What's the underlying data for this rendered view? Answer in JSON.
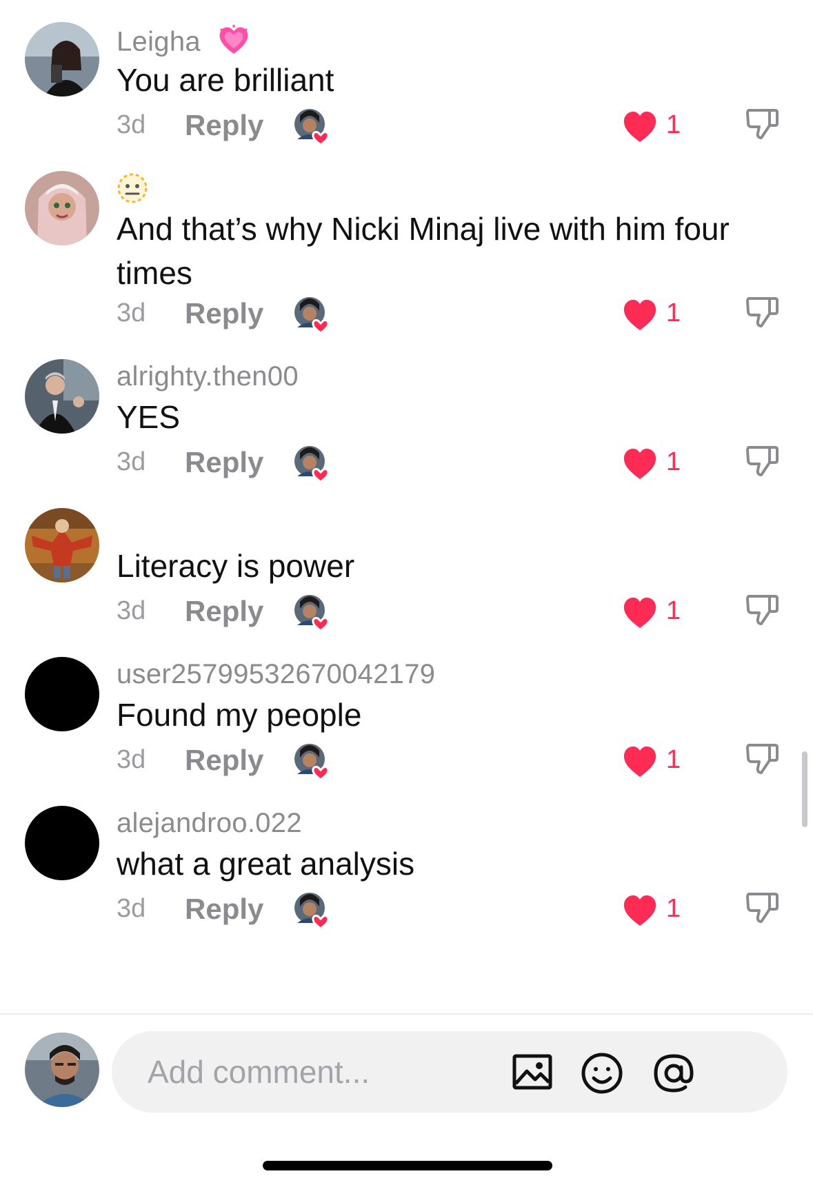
{
  "comments": [
    {
      "username": "Leigha",
      "badge": "heart-emoji",
      "text": "You are brilliant",
      "age": "3d",
      "reply_label": "Reply",
      "like_count": "1",
      "avatar_color": "#6d7c8a"
    },
    {
      "username": "",
      "badge": "neutral-face-emoji",
      "text": "And that’s why Nicki Minaj live with him four times",
      "age": "3d",
      "reply_label": "Reply",
      "like_count": "1",
      "avatar_color": "#c9a49b"
    },
    {
      "username": "alrighty.then00",
      "badge": "",
      "text": "YES",
      "age": "3d",
      "reply_label": "Reply",
      "like_count": "1",
      "avatar_color": "#4a5561"
    },
    {
      "username": "",
      "badge": "",
      "text": "Literacy is power",
      "age": "3d",
      "reply_label": "Reply",
      "like_count": "1",
      "avatar_color": "#a8642b"
    },
    {
      "username": "user257995326700421​79",
      "badge": "",
      "text": "Found my people",
      "age": "3d",
      "reply_label": "Reply",
      "like_count": "1",
      "avatar_color": "#000000"
    },
    {
      "username": "alejandroo.022",
      "badge": "",
      "text": "what a great analysis",
      "age": "3d",
      "reply_label": "Reply",
      "like_count": "1",
      "avatar_color": "#000000"
    }
  ],
  "composer": {
    "placeholder": "Add comment..."
  },
  "colors": {
    "like_red": "#fe2c55",
    "muted_text": "#8a8a8f",
    "text": "#111111",
    "input_bg": "#f1f1f2"
  },
  "icons": {
    "like": "heart-icon",
    "dislike": "thumbs-down-icon",
    "image": "image-icon",
    "emoji": "emoji-icon",
    "mention": "at-icon"
  }
}
